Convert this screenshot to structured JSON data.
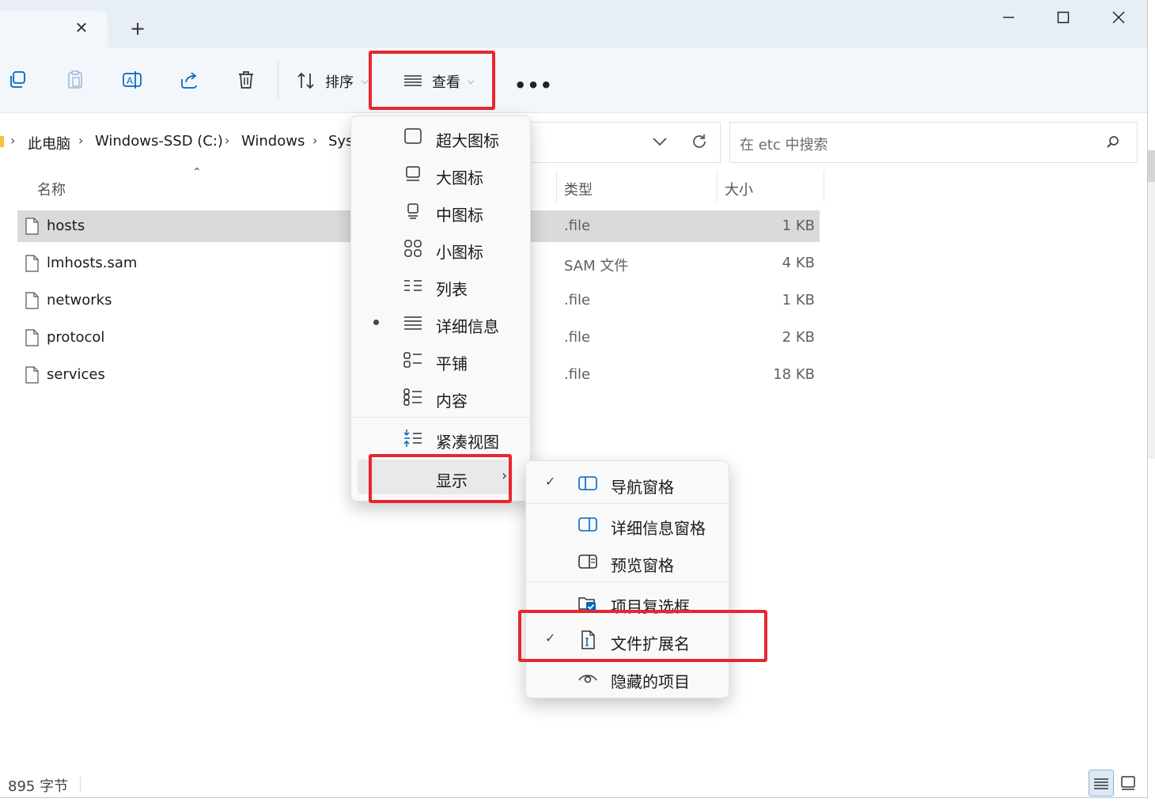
{
  "titlebar": {
    "tab_close": "✕",
    "new_tab": "+"
  },
  "toolbar": {
    "sort_label": "排序",
    "view_label": "查看",
    "more_label": "•••"
  },
  "address": {
    "crumbs": [
      "此电脑",
      "Windows-SSD (C:)",
      "Windows",
      "Sys"
    ],
    "separator": "›"
  },
  "search": {
    "placeholder": "在 etc 中搜索"
  },
  "columns": {
    "name": "名称",
    "type": "类型",
    "size": "大小"
  },
  "files": [
    {
      "name": "hosts",
      "type": ".file",
      "size": "1 KB",
      "selected": true
    },
    {
      "name": "lmhosts.sam",
      "type": "SAM 文件",
      "size": "4 KB",
      "selected": false
    },
    {
      "name": "networks",
      "type": ".file",
      "size": "1 KB",
      "selected": false
    },
    {
      "name": "protocol",
      "type": ".file",
      "size": "2 KB",
      "selected": false
    },
    {
      "name": "services",
      "type": ".file",
      "size": "18 KB",
      "selected": false
    }
  ],
  "status": {
    "text": "895 字节"
  },
  "view_menu": {
    "items": [
      {
        "label": "超大图标",
        "icon": "extra-large-icons-icon"
      },
      {
        "label": "大图标",
        "icon": "large-icons-icon"
      },
      {
        "label": "中图标",
        "icon": "medium-icons-icon"
      },
      {
        "label": "小图标",
        "icon": "small-icons-icon"
      },
      {
        "label": "列表",
        "icon": "list-icon"
      },
      {
        "label": "详细信息",
        "icon": "details-icon",
        "selected": true
      },
      {
        "label": "平铺",
        "icon": "tiles-icon"
      },
      {
        "label": "内容",
        "icon": "content-icon"
      }
    ],
    "compact": "紧凑视图",
    "show": "显示"
  },
  "show_menu": {
    "nav_pane": "导航窗格",
    "details_pane": "详细信息窗格",
    "preview_pane": "预览窗格",
    "item_checkboxes": "项目复选框",
    "file_extensions": "文件扩展名",
    "hidden_items": "隐藏的项目",
    "nav_pane_checked": true,
    "file_extensions_checked": true
  },
  "colors": {
    "highlight": "#e8262f",
    "accent": "#0067c0",
    "selected_row": "#dadada"
  }
}
